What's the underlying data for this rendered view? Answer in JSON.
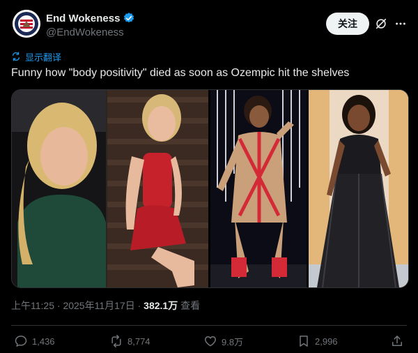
{
  "header": {
    "display_name": "End Wokeness",
    "handle": "@EndWokeness",
    "follow_label": "关注",
    "colors": {
      "verified": "#1d9bf0",
      "follow_bg": "#eff3f4"
    }
  },
  "translate": {
    "label": "显示翻译"
  },
  "tweet": {
    "text": "Funny how \"body positivity\" died as soon as Ozempic hit the shelves"
  },
  "meta": {
    "time": "上午11:25",
    "sep1": " · ",
    "date": "2025年11月17日",
    "sep2": " · ",
    "views_count": "382.1万",
    "views_label": " 查看"
  },
  "actions": {
    "reply_count": "1,436",
    "retweet_count": "8,774",
    "like_count": "9.8万",
    "bookmark_count": "2,996"
  },
  "icons": [
    "avatar-logo",
    "verified-badge-icon",
    "grok-icon",
    "more-icon",
    "translate-icon",
    "reply-icon",
    "retweet-icon",
    "like-icon",
    "bookmark-icon",
    "share-icon"
  ]
}
